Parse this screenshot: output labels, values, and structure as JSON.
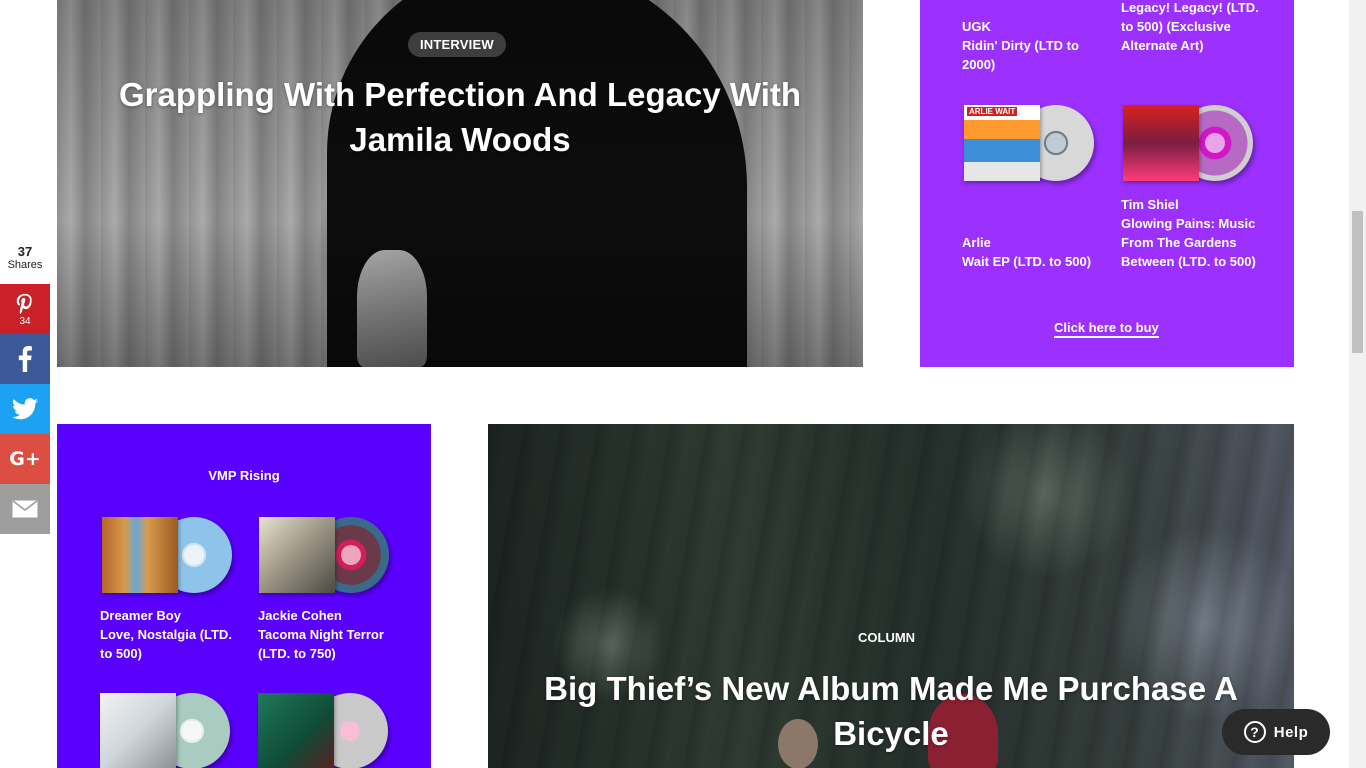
{
  "feature_top": {
    "tag": "INTERVIEW",
    "title": "Grappling With Perfection And Legacy With Jamila Woods"
  },
  "shop_panel": {
    "items": [
      {
        "artist": "UGK",
        "title": "Ridin' Dirty (LTD to 2000)"
      },
      {
        "artist": "",
        "title": "Legacy! Legacy! (LTD. to 500) (Exclusive Alternate Art)"
      },
      {
        "artist": "Arlie",
        "title": "Wait EP (LTD. to 500)",
        "sleeve_text": "ARLIE WAIT"
      },
      {
        "artist": "Tim Shiel",
        "title": "Glowing Pains: Music From The Gardens Between (LTD. to 500)"
      }
    ],
    "cta": "Click here to buy",
    "color": "#9b30ff"
  },
  "rising_panel": {
    "heading": "VMP Rising",
    "items": [
      {
        "artist": "Dreamer Boy",
        "title": "Love, Nostalgia (LTD. to 500)"
      },
      {
        "artist": "Jackie Cohen",
        "title": "Tacoma Night Terror (LTD. to 750)"
      },
      {
        "artist": "",
        "title": ""
      },
      {
        "artist": "",
        "title": ""
      }
    ],
    "color": "#5a00ff"
  },
  "feature_bottom": {
    "tag": "COLUMN",
    "title": "Big Thief’s New Album Made Me Purchase A Bicycle"
  },
  "share_bar": {
    "count": "37",
    "label": "Shares",
    "buttons": [
      {
        "network": "pinterest",
        "icon": "pinterest-icon",
        "count": "34",
        "color": "#cb2027"
      },
      {
        "network": "facebook",
        "icon": "facebook-icon",
        "count": "",
        "color": "#3b5998"
      },
      {
        "network": "twitter",
        "icon": "twitter-icon",
        "count": "",
        "color": "#1da1f2"
      },
      {
        "network": "google-plus",
        "icon": "google-plus-icon",
        "count": "",
        "color": "#dc4e41"
      },
      {
        "network": "email",
        "icon": "email-icon",
        "count": "",
        "color": "#9e9e9e"
      }
    ]
  },
  "help": {
    "label": "Help",
    "icon": "question-circle-icon"
  }
}
